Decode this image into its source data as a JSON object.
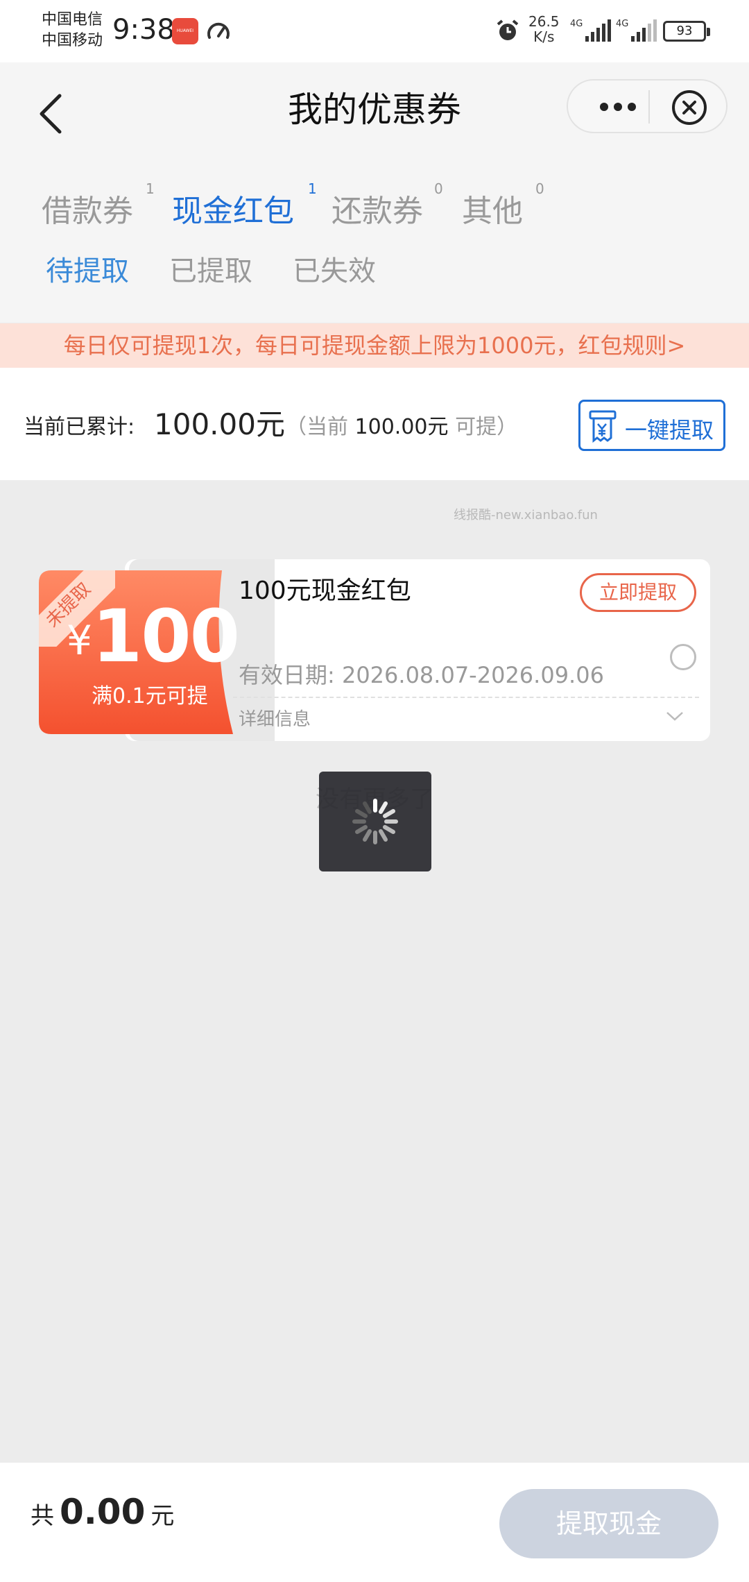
{
  "status_bar": {
    "carrier_1": "中国电信",
    "carrier_2": "中国移动",
    "time": "9:38",
    "app_badge": "HUAWEI",
    "net_speed_value": "26.5",
    "net_speed_unit": "K/s",
    "signal_1": "4G",
    "signal_2": "4G",
    "battery": "93"
  },
  "header": {
    "title": "我的优惠券"
  },
  "tabs": [
    {
      "label": "借款券",
      "count": "1"
    },
    {
      "label": "现金红包",
      "count": "1"
    },
    {
      "label": "还款券",
      "count": "0"
    },
    {
      "label": "其他",
      "count": "0"
    }
  ],
  "active_tab": "现金红包",
  "subtabs": [
    {
      "label": "待提取"
    },
    {
      "label": "已提取"
    },
    {
      "label": "已失效"
    }
  ],
  "notice": "每日仅可提现1次，每日可提现金额上限为1000元，红包规则>",
  "accumulated": {
    "label": "当前已累计:",
    "amount": "100.00元",
    "avail_prefix": "（当前",
    "avail_amount": "100.00元",
    "avail_suffix": "可提）",
    "button_label": "一键提取"
  },
  "watermark": "线报酷-new.xianbao.fun",
  "coupon": {
    "ribbon": "未提取",
    "currency": "¥",
    "value": "100",
    "threshold": "满0.1元可提",
    "name": "100元现金红包",
    "claim_label": "立即提取",
    "validity": "有效日期:  2026.08.07-2026.09.06",
    "detail_label": "详细信息"
  },
  "list_end": "没有更多了",
  "bottom_bar": {
    "total_prefix": "共",
    "total_value": "0.00",
    "total_unit": "元",
    "withdraw_label": "提取现金"
  },
  "colors": {
    "accent_blue": "#1f6fd6",
    "coupon_orange": "#f5523a",
    "notice_bg": "#fde1d8",
    "notice_text": "#e8704e",
    "disabled_button": "#ccd3df"
  }
}
